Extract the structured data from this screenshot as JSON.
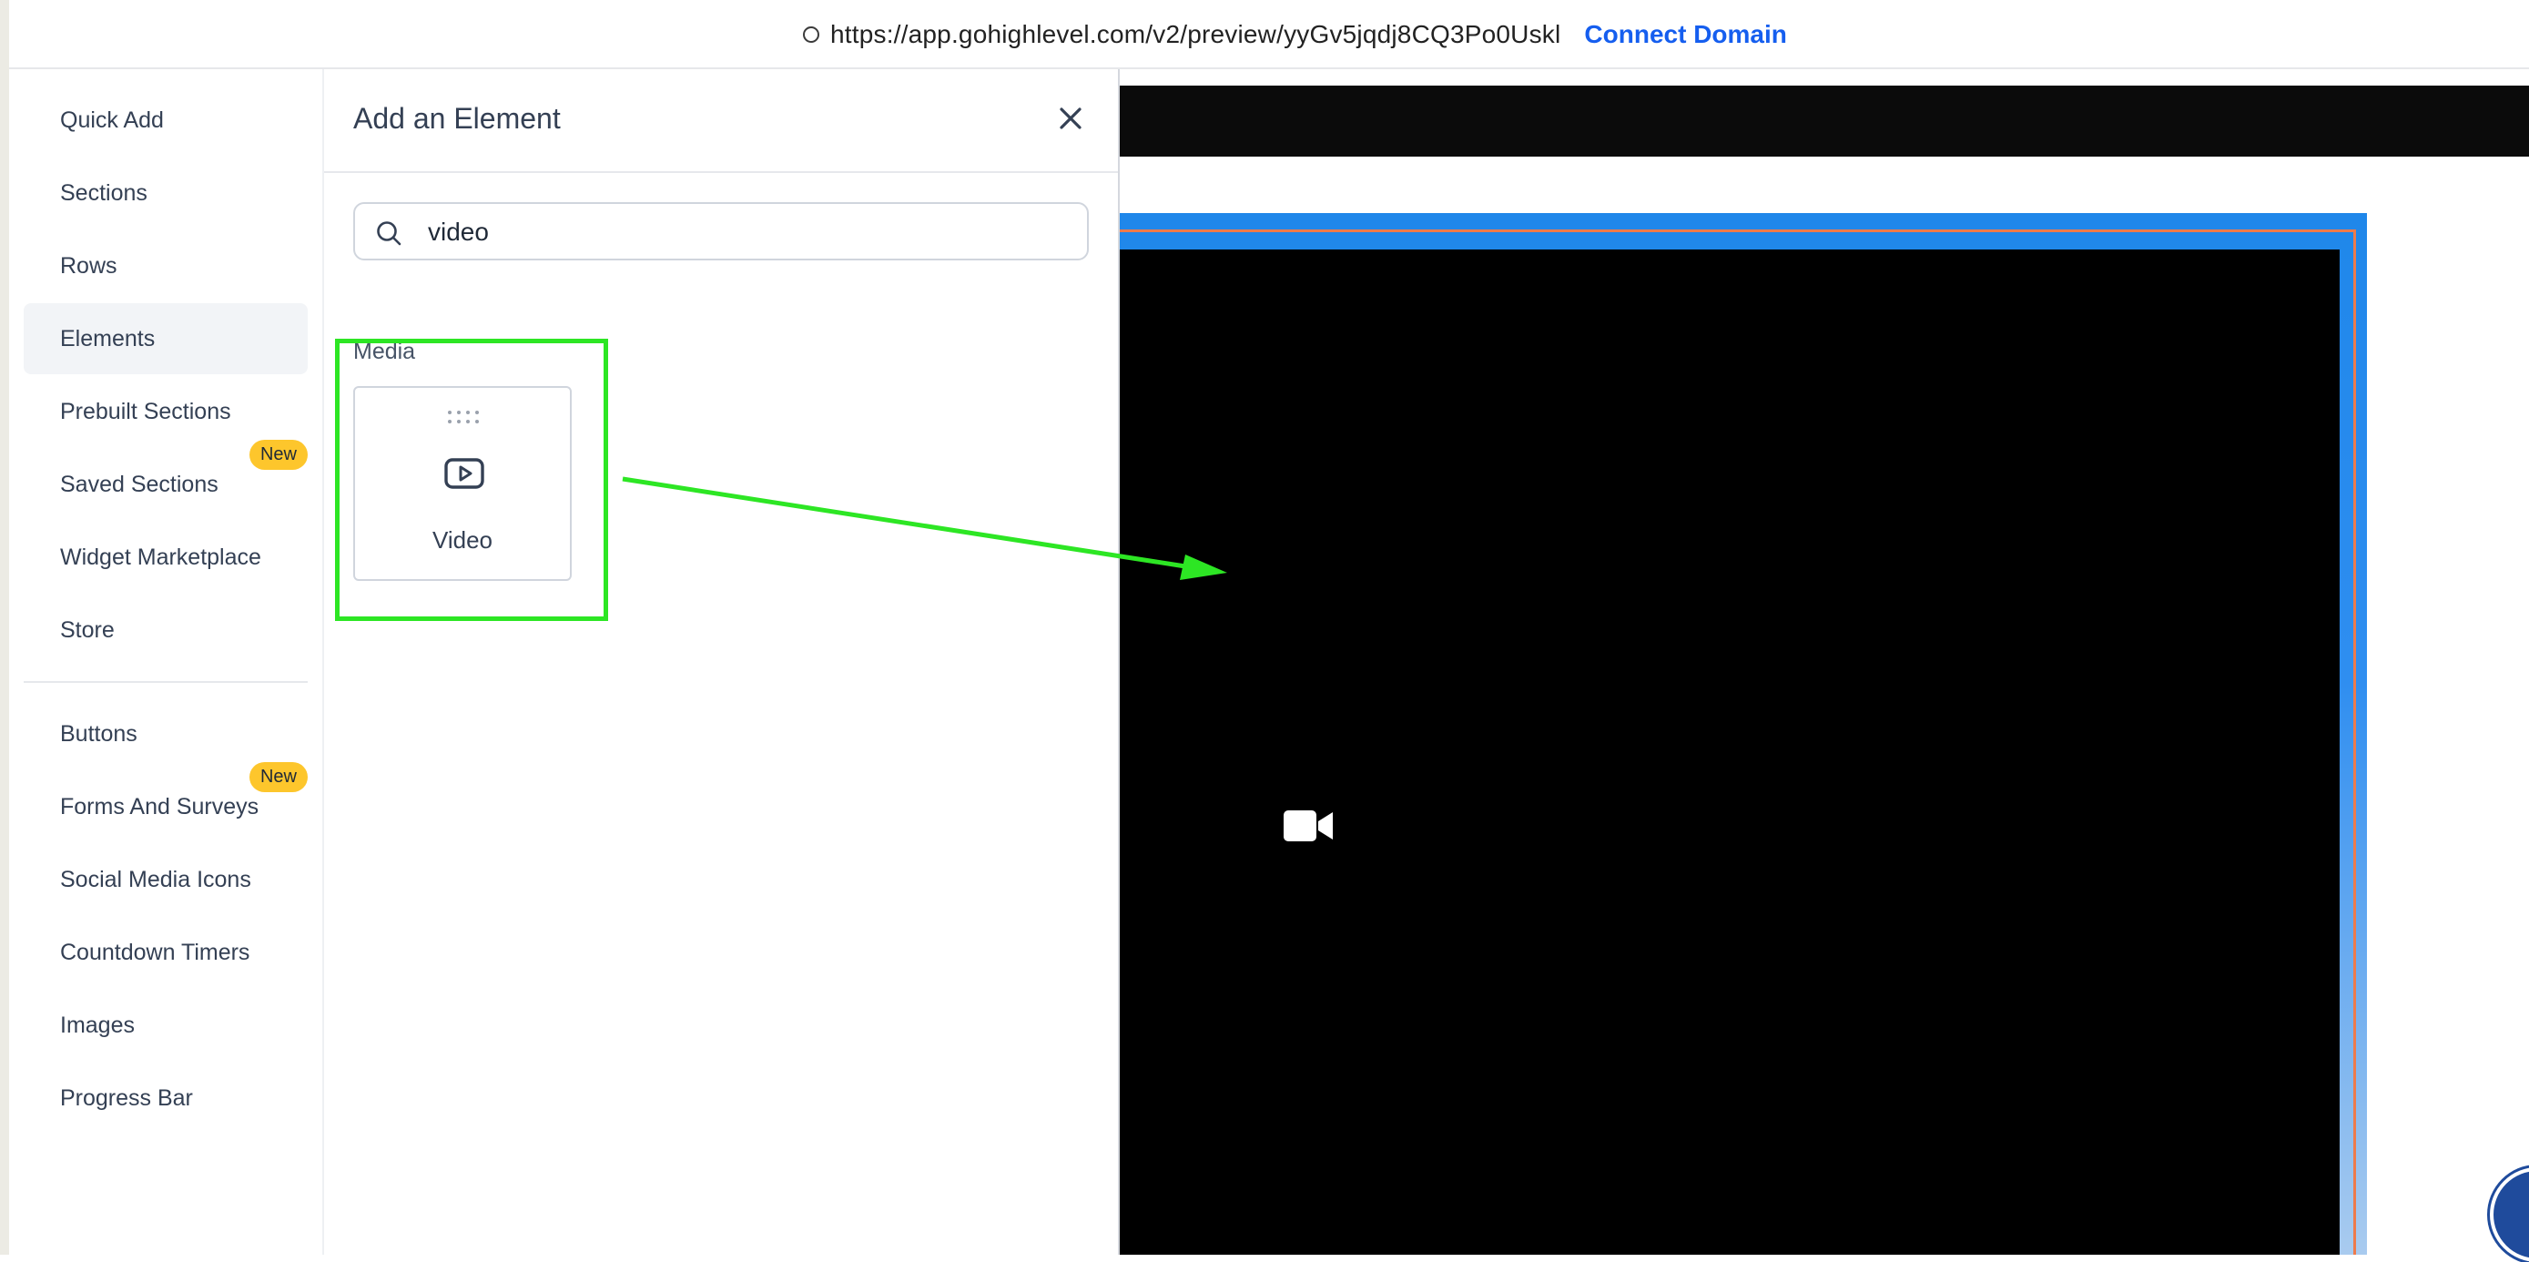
{
  "browser": {
    "url": "https://app.gohighlevel.com/v2/preview/yyGv5jqdj8CQ3Po0Uskl",
    "connect_domain": "Connect Domain"
  },
  "sidebar": {
    "items": [
      {
        "label": "Quick Add"
      },
      {
        "label": "Sections"
      },
      {
        "label": "Rows"
      },
      {
        "label": "Elements",
        "active": true
      },
      {
        "label": "Prebuilt Sections"
      },
      {
        "label": "Saved Sections",
        "badge": "New"
      },
      {
        "label": "Widget Marketplace"
      },
      {
        "label": "Store"
      },
      {
        "label": "Buttons"
      },
      {
        "label": "Forms And Surveys",
        "badge": "New"
      },
      {
        "label": "Social Media Icons"
      },
      {
        "label": "Countdown Timers"
      },
      {
        "label": "Images"
      },
      {
        "label": "Progress Bar"
      }
    ]
  },
  "panel": {
    "title": "Add an Element",
    "search_value": "video",
    "category": "Media",
    "cards": [
      {
        "label": "Video",
        "icon": "play-icon"
      }
    ]
  },
  "colors": {
    "highlight": "#2de624",
    "accent_blue": "#155eef",
    "badge": "#fdc62c"
  }
}
